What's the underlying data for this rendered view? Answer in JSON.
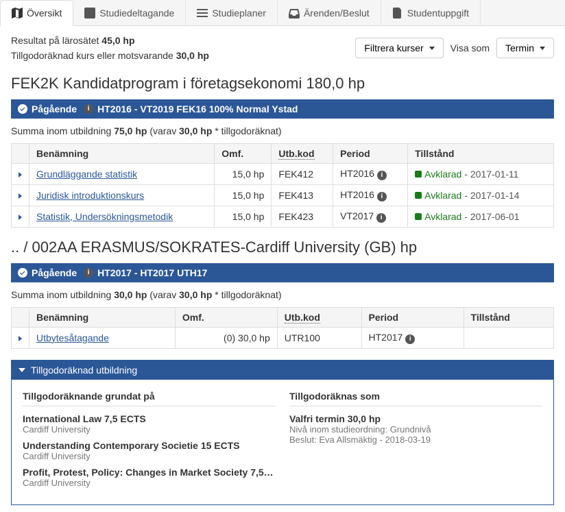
{
  "tabs": {
    "overview": "Översikt",
    "participation": "Studiedeltagande",
    "plans": "Studieplaner",
    "cases": "Ärenden/Beslut",
    "studentinfo": "Studentuppgift"
  },
  "topbar": {
    "result_label": "Resultat på lärosätet ",
    "result_value": "45,0 hp",
    "credited_label": "Tillgodoräknad kurs eller motsvarande ",
    "credited_value": "30,0 hp",
    "filter_btn": "Filtrera kurser ",
    "view_as": "Visa som",
    "term_btn": "Termin "
  },
  "program1": {
    "title": "FEK2K Kandidatprogram i företagsekonomi 180,0 hp",
    "status_label": "Pågående",
    "status_detail": "HT2016 - VT2019 FEK16 100% Normal Ystad",
    "summary_pre": "Summa inom utbildning ",
    "summary_bold": "75,0 hp",
    "summary_mid": " (varav ",
    "summary_credit": "30,0 hp",
    "summary_post": "* tillgodoräknat)",
    "headers": {
      "name": "Benämning",
      "scope": "Omf.",
      "code": "Utb.kod",
      "period": "Period",
      "state": "Tillstånd"
    },
    "courses": [
      {
        "name": "Grundläggande statistik",
        "scope": "15,0 hp",
        "code": "FEK412",
        "period": "HT2016",
        "state": "Avklarad",
        "date": " - 2017-01-11"
      },
      {
        "name": "Juridisk introduktionskurs",
        "scope": "15,0 hp",
        "code": "FEK413",
        "period": "HT2016",
        "state": "Avklarad",
        "date": " - 2017-01-14"
      },
      {
        "name": "Statistik, Undersökningsmetodik",
        "scope": "15,0 hp",
        "code": "FEK423",
        "period": "VT2017",
        "state": "Avklarad",
        "date": " - 2017-06-01"
      }
    ]
  },
  "program2": {
    "title": ".. / 002AA ERASMUS/SOKRATES-Cardiff University (GB) hp",
    "status_label": "Pågående",
    "status_detail": "HT2017 - HT2017 UTH17",
    "summary_pre": "Summa inom utbildning ",
    "summary_bold": "30,0 hp",
    "summary_mid": " (varav ",
    "summary_credit": "30,0 hp",
    "summary_post": "* tillgodoräknat)",
    "headers": {
      "name": "Benämning",
      "scope": "Omf.",
      "code": "Utb.kod",
      "period": "Period",
      "state": "Tillstånd"
    },
    "courses": [
      {
        "name": "Utbytesåtagande",
        "scope": "(0) 30,0 hp",
        "code": "UTR100",
        "period": "HT2017",
        "state": "",
        "date": ""
      }
    ]
  },
  "credit_transfer": {
    "header": "Tillgodoräknad utbildning",
    "left_header": "Tillgodoräknande grundat på",
    "right_header": "Tillgodoräknas som",
    "left_items": [
      {
        "title": "International Law 7,5 ECTS",
        "sub": "Cardiff University"
      },
      {
        "title": "Understanding Contemporary Societie 15 ECTS",
        "sub": "Cardiff University"
      },
      {
        "title": "Profit, Protest, Policy: Changes in Market Society 7,5…",
        "sub": "Cardiff University"
      }
    ],
    "right_main": "Valfri termin 30,0 hp",
    "right_level": "Nivå inom studieordning: Grundnivå",
    "right_decision": "Beslut: Eva Allsmäktig - 2018-03-19"
  }
}
